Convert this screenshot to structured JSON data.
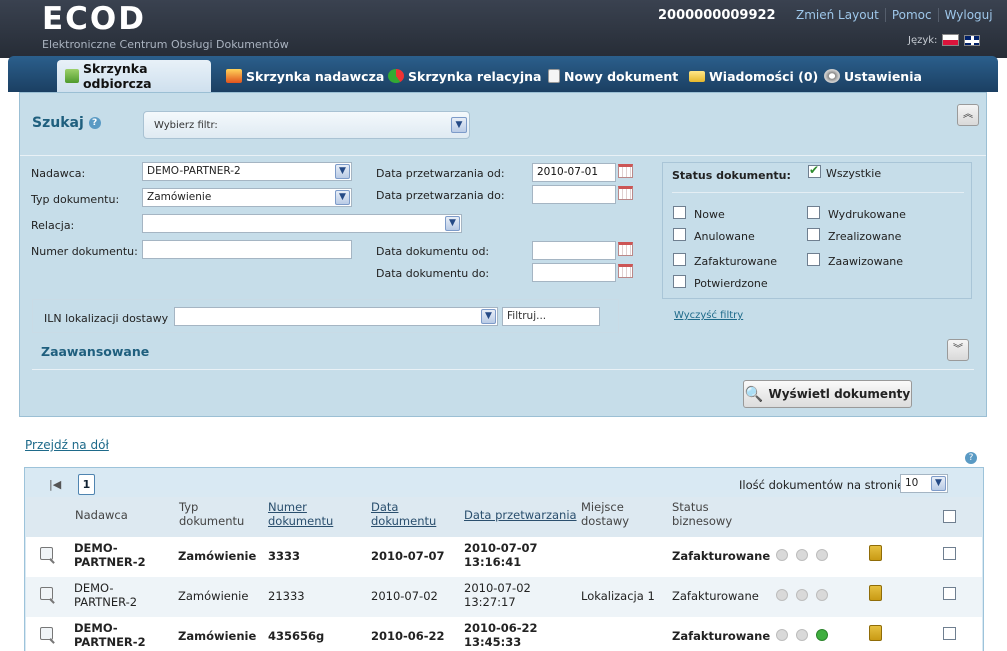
{
  "header": {
    "logo": "ECOD",
    "logo_sub": "Elektroniczne Centrum Obsługi Dokumentów",
    "account": "2000000009922",
    "links": [
      "Zmień Layout",
      "Pomoc",
      "Wyloguj"
    ],
    "lang_label": "Język:"
  },
  "tabs": [
    {
      "label": "Skrzynka odbiorcza",
      "active": true
    },
    {
      "label": "Skrzynka nadawcza"
    },
    {
      "label": "Skrzynka relacyjna"
    },
    {
      "label": "Nowy dokument"
    },
    {
      "label": "Wiadomości (0)"
    },
    {
      "label": "Ustawienia"
    }
  ],
  "search": {
    "title": "Szukaj",
    "filter_placeholder": "Wybierz filtr:",
    "nadawca_label": "Nadawca:",
    "nadawca_value": "DEMO-PARTNER-2",
    "typ_label": "Typ dokumentu:",
    "typ_value": "Zamówienie",
    "relacja_label": "Relacja:",
    "numer_label": "Numer dokumentu:",
    "dp_od_label": "Data przetwarzania od:",
    "dp_od_value": "2010-07-01",
    "dp_do_label": "Data przetwarzania do:",
    "dd_od_label": "Data dokumentu od:",
    "dd_do_label": "Data dokumentu do:",
    "iln_label": "ILN lokalizacji dostawy",
    "filtruj_placeholder": "Filtruj...",
    "clear_label": "Wyczyść filtry",
    "advanced_label": "Zaawansowane",
    "show_button": "Wyświetl dokumenty"
  },
  "status": {
    "title": "Status dokumentu:",
    "all_label": "Wszystkie",
    "options": [
      "Nowe",
      "Wydrukowane",
      "Anulowane",
      "Zrealizowane",
      "Zafakturowane",
      "Zaawizowane",
      "Potwierdzone"
    ]
  },
  "list": {
    "goto_bottom": "Przejdź na dół",
    "current_page": "1",
    "per_page_label": "Ilość dokumentów na stronie:",
    "per_page_value": "10",
    "columns": {
      "nadawca": "Nadawca",
      "typ1": "Typ",
      "typ2": "dokumentu",
      "numer1": "Numer",
      "numer2": "dokumentu",
      "data1": "Data",
      "data2": "dokumentu",
      "przetw": "Data przetwarzania",
      "miejsce1": "Miejsce",
      "miejsce2": "dostawy",
      "status1": "Status",
      "status2": "biznesowy"
    },
    "rows": [
      {
        "nadawca1": "DEMO-",
        "nadawca2": "PARTNER-2",
        "typ": "Zamówienie",
        "numer": "3333",
        "data": "2010-07-07",
        "przetw1": "2010-07-07",
        "przetw2": "13:16:41",
        "miejsce": "",
        "status": "Zafakturowane",
        "bold": true
      },
      {
        "nadawca1": "DEMO-",
        "nadawca2": "PARTNER-2",
        "typ": "Zamówienie",
        "numer": "21333",
        "data": "2010-07-02",
        "przetw1": "2010-07-02",
        "przetw2": "13:27:17",
        "miejsce": "Lokalizacja 1",
        "status": "Zafakturowane",
        "bold": false
      },
      {
        "nadawca1": "DEMO-",
        "nadawca2": "PARTNER-2",
        "typ": "Zamówienie",
        "numer": "435656g",
        "data": "2010-06-22",
        "przetw1": "2010-06-22",
        "przetw2": "13:45:33",
        "miejsce": "",
        "status": "Zafakturowane",
        "bold": true
      }
    ]
  }
}
